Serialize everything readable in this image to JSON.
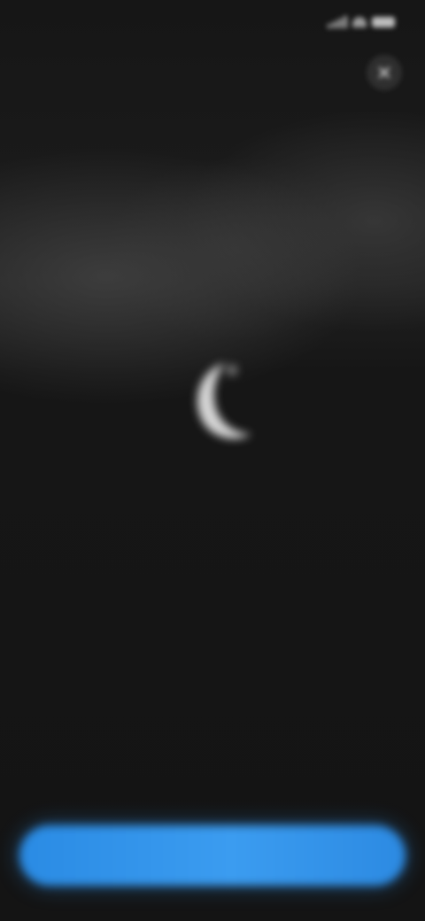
{
  "status_bar": {
    "time": "",
    "icons": [
      "signal-icon",
      "wifi-icon",
      "battery-icon"
    ]
  },
  "header": {
    "close_icon": "close-icon"
  },
  "hero": {
    "icon": "moon-icon",
    "title": "",
    "subtitle": ""
  },
  "footer": {
    "primary_button_label": ""
  },
  "colors": {
    "background": "#141414",
    "accent": "#2a8be4",
    "text_primary": "#ffffff",
    "text_secondary": "#c8c8c8"
  }
}
